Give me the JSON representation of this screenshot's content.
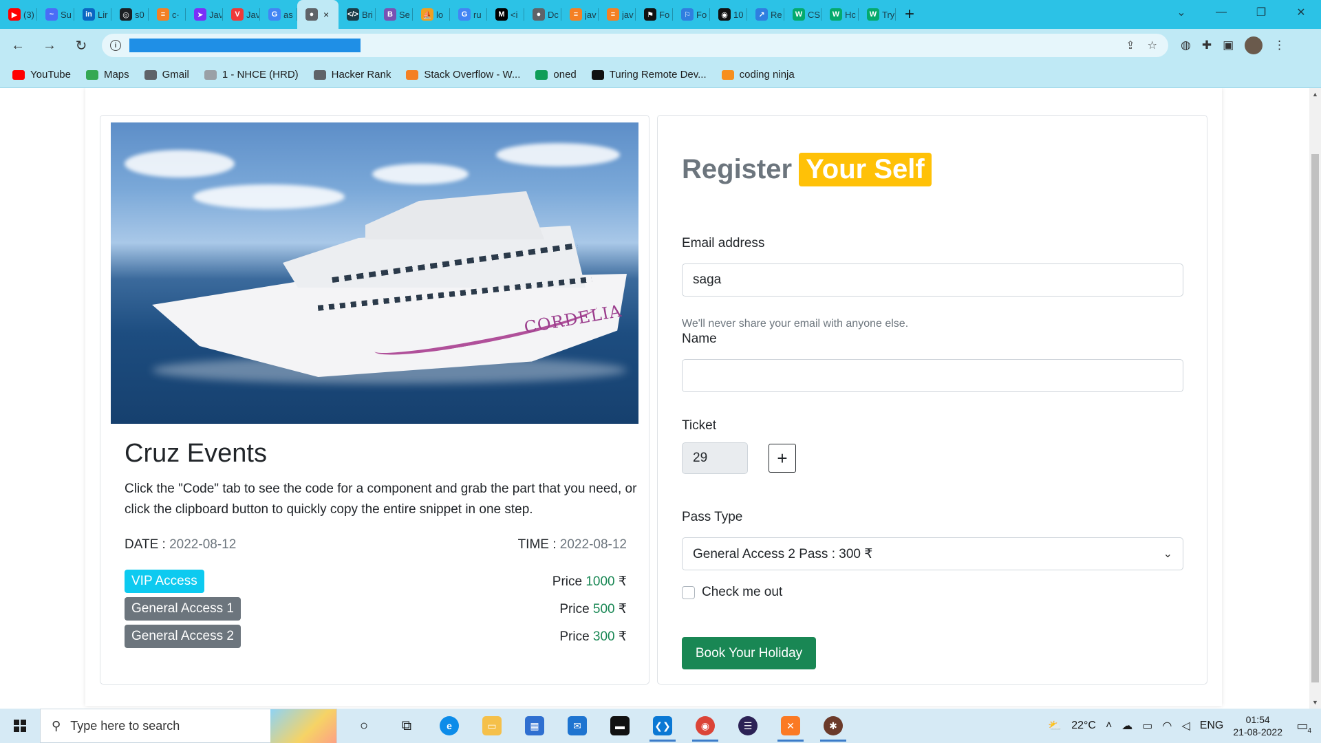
{
  "browser": {
    "tabs": [
      {
        "label": "(3)",
        "icon": "youtube-icon",
        "color": "#ff0000",
        "glyph": "▶"
      },
      {
        "label": "Su",
        "icon": "meet-icon",
        "color": "#4a6cf7",
        "glyph": "~"
      },
      {
        "label": "Lir",
        "icon": "linkedin-icon",
        "color": "#0a66c2",
        "glyph": "in"
      },
      {
        "label": "s0",
        "icon": "github-icon",
        "color": "#1b1f23",
        "glyph": "◎"
      },
      {
        "label": "c·",
        "icon": "stackoverflow-icon",
        "color": "#f48024",
        "glyph": "≡"
      },
      {
        "label": "Jav",
        "icon": "bookmark-icon",
        "color": "#7b2ff7",
        "glyph": "➤"
      },
      {
        "label": "Jav",
        "icon": "vivaldi-icon",
        "color": "#ef3939",
        "glyph": "V"
      },
      {
        "label": "as",
        "icon": "google-icon",
        "color": "#4285f4",
        "glyph": "G"
      },
      {
        "label": "×",
        "icon": "globe-icon",
        "color": "#5f6368",
        "glyph": "●",
        "active": true
      },
      {
        "label": "Bri",
        "icon": "code-icon",
        "color": "#1a3b47",
        "glyph": "</>"
      },
      {
        "label": "Se",
        "icon": "bootstrap-icon",
        "color": "#7952b3",
        "glyph": "B"
      },
      {
        "label": "lo",
        "icon": "sail-icon",
        "color": "#f0a020",
        "glyph": "⛵"
      },
      {
        "label": "ru",
        "icon": "google-icon",
        "color": "#4285f4",
        "glyph": "G"
      },
      {
        "label": "<i",
        "icon": "medium-icon",
        "color": "#000000",
        "glyph": "M"
      },
      {
        "label": "Dc",
        "icon": "globe-icon",
        "color": "#5f6368",
        "glyph": "●"
      },
      {
        "label": "jav",
        "icon": "stackoverflow-icon",
        "color": "#f48024",
        "glyph": "≡"
      },
      {
        "label": "jav",
        "icon": "stackoverflow-icon",
        "color": "#f48024",
        "glyph": "≡"
      },
      {
        "label": "Fo",
        "icon": "flag-icon",
        "color": "#111111",
        "glyph": "⚑"
      },
      {
        "label": "Fo",
        "icon": "flag-icon",
        "color": "#2f7ee0",
        "glyph": "⚐"
      },
      {
        "label": "10",
        "icon": "app-icon",
        "color": "#111111",
        "glyph": "◉"
      },
      {
        "label": "Re",
        "icon": "chart-icon",
        "color": "#2f7ee0",
        "glyph": "↗"
      },
      {
        "label": "CS",
        "icon": "w3-icon",
        "color": "#04aa6d",
        "glyph": "W"
      },
      {
        "label": "Hc",
        "icon": "w3-icon",
        "color": "#04aa6d",
        "glyph": "W"
      },
      {
        "label": "Try",
        "icon": "w3-icon",
        "color": "#04aa6d",
        "glyph": "W"
      }
    ],
    "new_tab": "+",
    "bookmarks": [
      {
        "label": "YouTube",
        "icon": "youtube-icon",
        "color": "#ff0000"
      },
      {
        "label": "Maps",
        "icon": "maps-icon",
        "color": "#34a853"
      },
      {
        "label": "Gmail",
        "icon": "globe-icon",
        "color": "#5f6368"
      },
      {
        "label": "1 - NHCE (HRD)",
        "icon": "doc-icon",
        "color": "#9aa0a6"
      },
      {
        "label": "Hacker Rank",
        "icon": "globe-icon",
        "color": "#5f6368"
      },
      {
        "label": "Stack Overflow - W...",
        "icon": "stackoverflow-icon",
        "color": "#f48024"
      },
      {
        "label": "oned",
        "icon": "plus-doc-icon",
        "color": "#0f9d58"
      },
      {
        "label": "Turing Remote Dev...",
        "icon": "turing-icon",
        "color": "#111111"
      },
      {
        "label": "coding ninja",
        "icon": "ninja-icon",
        "color": "#f78f1e"
      }
    ]
  },
  "event": {
    "title": "Cruz Events",
    "description": "Click the \"Code\" tab to see the code for a component and grab the part that you need, or click the clipboard button to quickly copy the entire snippet in one step.",
    "date_label": "DATE :",
    "date_value": "2022-08-12",
    "time_label": "TIME :",
    "time_value": "2022-08-12",
    "image_brand": "CORDELIA",
    "passes": [
      {
        "name": "VIP Access",
        "price_label": "Price",
        "price": "1000",
        "currency": "₹",
        "badge": "info"
      },
      {
        "name": "General Access 1",
        "price_label": "Price",
        "price": "500",
        "currency": "₹",
        "badge": "secondary"
      },
      {
        "name": "General Access 2",
        "price_label": "Price",
        "price": "300",
        "currency": "₹",
        "badge": "secondary"
      }
    ]
  },
  "form": {
    "title_part1": "Register",
    "title_part2": "Your Self",
    "email_label": "Email address",
    "email_value": "saga",
    "email_help": "We'll never share your email with anyone else.",
    "name_label": "Name",
    "name_value": "",
    "ticket_label": "Ticket",
    "ticket_value": "29",
    "plus_label": "+",
    "pass_label": "Pass Type",
    "pass_selected": "General Access 2 Pass : 300 ₹",
    "checkbox_label": "Check me out",
    "submit_label": "Book Your Holiday"
  },
  "taskbar": {
    "search_placeholder": "Type here to search",
    "weather": "22°C",
    "language": "ENG",
    "time": "01:54",
    "date": "21-08-2022",
    "notification_count": "4"
  },
  "colors": {
    "primary_accent": "#ffc107",
    "success": "#198754",
    "info": "#0dcaf0",
    "secondary": "#6c757d",
    "browser_frame": "#2cc2e6"
  }
}
